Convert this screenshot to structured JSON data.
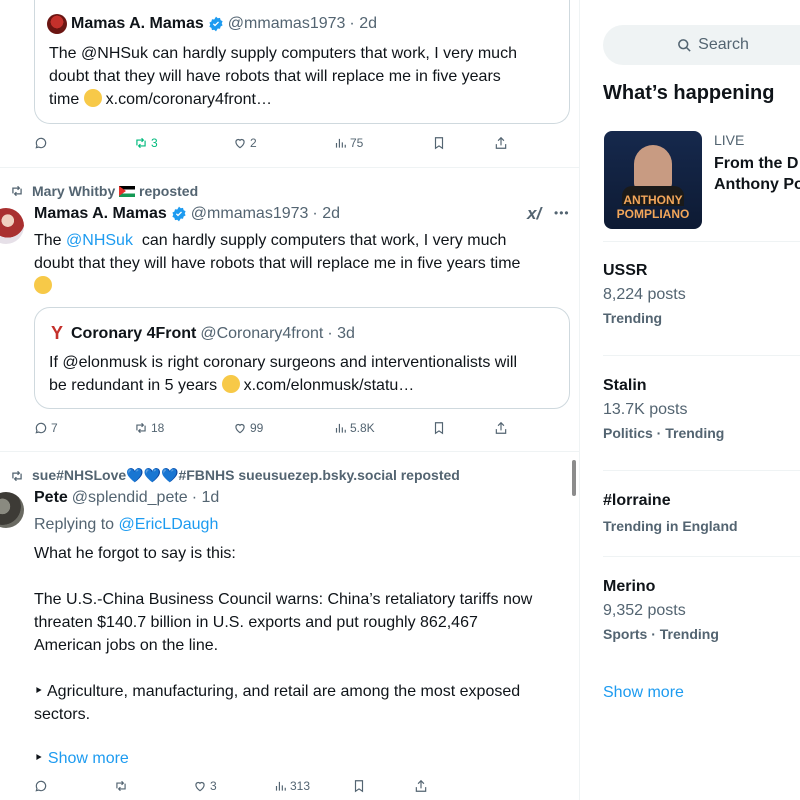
{
  "post1": {
    "quote": {
      "name": "Mamas A. Mamas",
      "handle": "@mmamas1973",
      "time": "· 2d",
      "line1": "The @NHSuk  can hardly supply computers that work, I very much",
      "line2": "doubt that they will have robots that will replace me in five years",
      "line3_text": "time ",
      "line3_link": "x.com/coronary4front…"
    },
    "actions": {
      "reposts": "3",
      "likes": "2",
      "views": "75"
    }
  },
  "post2": {
    "reposted_by": "Mary Whitby",
    "reposted_suffix": "reposted",
    "name": "Mamas A. Mamas",
    "handle": "@mmamas1973",
    "time": "· 2d",
    "line1_a": "The ",
    "line1_mention": "@NHSuk",
    "line1_b": "  can hardly supply computers that work, I very much",
    "line2": "doubt that they will have robots that will replace me in five years time",
    "quote": {
      "name": "Coronary 4Front",
      "handle": "@Coronary4front",
      "time": "· 3d",
      "line1": "If @elonmusk is right coronary surgeons and interventionalists will",
      "line2_text": "be redundant in 5 years ",
      "line2_link": "x.com/elonmusk/statu…"
    },
    "actions": {
      "replies": "7",
      "reposts": "18",
      "likes": "99",
      "views": "5.8K"
    }
  },
  "post3": {
    "reposted_by_a": "sue#NHSLove",
    "reposted_by_b": "#FBNHS sueusuezep.bsky.social reposted",
    "name": "Pete",
    "handle": "@splendid_pete",
    "time": "· 1d",
    "replying_label": "Replying to ",
    "replying_to": "@EricLDaugh",
    "p1": "What he forgot to say is this:",
    "p2_l1": "The U.S.-China Business Council warns: China’s retaliatory tariffs now",
    "p2_l2": "threaten $140.7 billion in U.S. exports and put roughly 862,467",
    "p2_l3": "American jobs on the line.",
    "p3_l1": "‣ Agriculture, manufacturing, and retail are among the most exposed",
    "p3_l2": "sectors.",
    "show_more_bullet": "‣",
    "show_more": "Show more",
    "actions": {
      "likes": "3",
      "views": "313"
    }
  },
  "sidebar": {
    "search_placeholder": "Search",
    "title": "What’s happening",
    "live": {
      "label": "LIVE",
      "title_l1": "From the D",
      "title_l2": "Anthony Po",
      "thumb_top": "ANTHONY",
      "thumb_bottom": "POMPLIANO"
    },
    "trends": [
      {
        "name": "USSR",
        "count": "8,224 posts",
        "meta": "Trending"
      },
      {
        "name": "Stalin",
        "count": "13.7K posts",
        "meta": "Politics · Trending"
      },
      {
        "name": "#lorraine",
        "count": "",
        "meta": "Trending in England"
      },
      {
        "name": "Merino",
        "count": "9,352 posts",
        "meta": "Sports · Trending"
      }
    ],
    "show_more": "Show more"
  },
  "colors": {
    "accent": "#1d9bf0",
    "muted": "#536471",
    "repost_green": "#00ba7c"
  }
}
